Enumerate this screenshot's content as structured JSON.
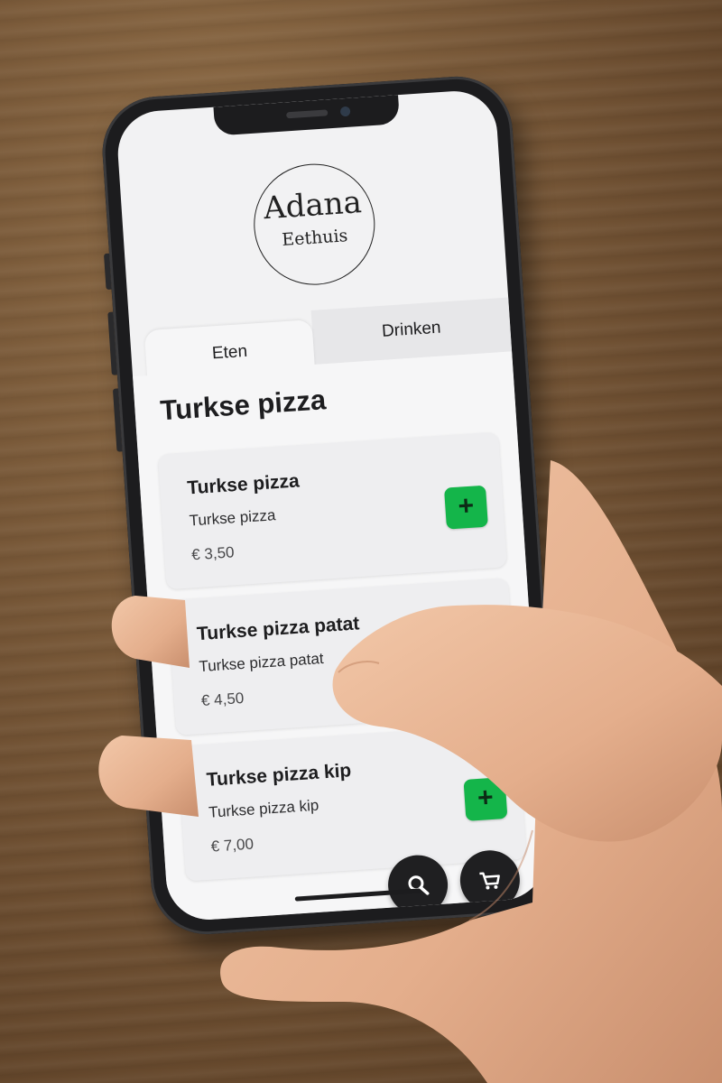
{
  "restaurant": {
    "name": "Adana",
    "subtitle": "Eethuis"
  },
  "tabs": [
    {
      "label": "Eten",
      "active": true
    },
    {
      "label": "Drinken",
      "active": false
    }
  ],
  "section": {
    "title": "Turkse pizza"
  },
  "items": [
    {
      "title": "Turkse pizza",
      "description": "Turkse pizza",
      "price": "€ 3,50",
      "add_label": "+"
    },
    {
      "title": "Turkse pizza patat",
      "description": "Turkse pizza patat",
      "price": "€ 4,50",
      "add_label": "+"
    },
    {
      "title": "Turkse pizza kip",
      "description": "Turkse pizza kip",
      "price": "€ 7,00",
      "add_label": "+"
    }
  ],
  "actions": {
    "search_icon": "search-icon",
    "cart_icon": "cart-icon"
  },
  "colors": {
    "accent": "#14b54a",
    "fab": "#1f1f21"
  }
}
